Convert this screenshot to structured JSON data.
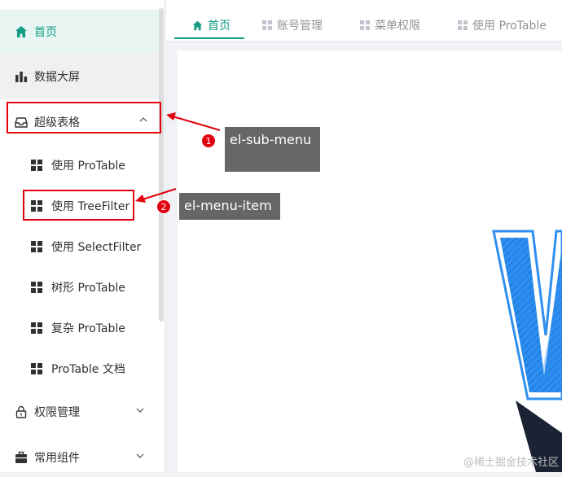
{
  "sidebar": {
    "home": "首页",
    "data_screen": "数据大屏",
    "super_table": "超级表格",
    "children": [
      "使用 ProTable",
      "使用 TreeFilter",
      "使用 SelectFilter",
      "树形 ProTable",
      "复杂 ProTable",
      "ProTable 文档"
    ],
    "permissions": "权限管理",
    "components": "常用组件"
  },
  "tabs": [
    "首页",
    "账号管理",
    "菜单权限",
    "使用 ProTable"
  ],
  "annotations": [
    {
      "number": "1",
      "label": "el-sub-menu"
    },
    {
      "number": "2",
      "label": "el-menu-item"
    }
  ],
  "watermark": "@稀土掘金技术社区",
  "colors": {
    "accent": "#109b85",
    "highlight": "#e3000f",
    "callout_bg": "#666666",
    "logo_blue": "#2f8ff0"
  }
}
